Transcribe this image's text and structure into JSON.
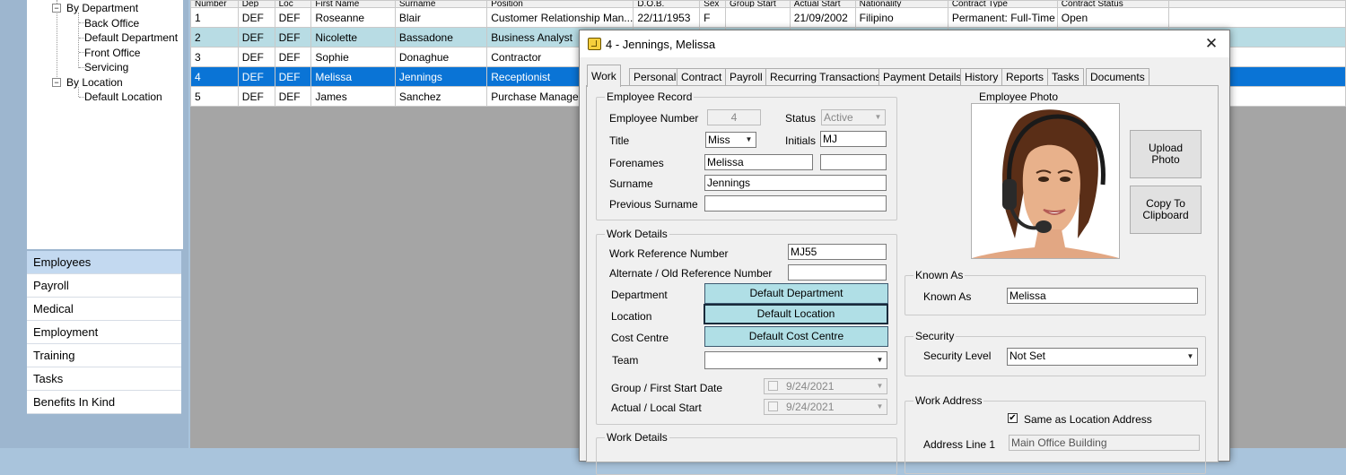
{
  "tree": {
    "by_department_label": "By Department",
    "departments": [
      "Back Office",
      "Default Department",
      "Front Office",
      "Servicing"
    ],
    "by_location_label": "By Location",
    "locations": [
      "Default Location"
    ],
    "expander": "−"
  },
  "modules": [
    "Employees",
    "Payroll",
    "Medical",
    "Employment",
    "Training",
    "Tasks",
    "Benefits In Kind"
  ],
  "grid": {
    "columns": [
      "Number",
      "Dep",
      "Loc",
      "First Name",
      "Surname",
      "Position",
      "D.O.B.",
      "Sex",
      "Group Start",
      "Actual Start",
      "Nationality",
      "Contract Type",
      "Contract Status"
    ],
    "rows": [
      [
        "1",
        "DEF",
        "DEF",
        "Roseanne",
        "Blair",
        "Customer Relationship Man...",
        "22/11/1953",
        "F",
        "",
        "21/09/2002",
        "Filipino",
        "Permanent: Full-Time",
        "Open"
      ],
      [
        "2",
        "DEF",
        "DEF",
        "Nicolette",
        "Bassadone",
        "Business Analyst",
        "",
        "",
        "",
        "",
        "",
        "",
        ""
      ],
      [
        "3",
        "DEF",
        "DEF",
        "Sophie",
        "Donaghue",
        "Contractor",
        "",
        "",
        "",
        "",
        "",
        "",
        ""
      ],
      [
        "4",
        "DEF",
        "DEF",
        "Melissa",
        "Jennings",
        "Receptionist",
        "",
        "",
        "",
        "",
        "",
        "",
        ""
      ],
      [
        "5",
        "DEF",
        "DEF",
        "James",
        "Sanchez",
        "Purchase Manager",
        "",
        "",
        "",
        "",
        "",
        "",
        ""
      ]
    ],
    "selected_row": 3
  },
  "dialog": {
    "title": "4 - Jennings, Melissa",
    "close_glyph": "✕",
    "tabs": [
      "Work",
      "Personal",
      "Contract",
      "Payroll",
      "Recurring Transactions",
      "Payment Details",
      "History",
      "Reports",
      "Tasks",
      "Documents"
    ],
    "active_tab": "Work",
    "employee_record": {
      "legend": "Employee Record",
      "employee_number_label": "Employee Number",
      "employee_number": "4",
      "status_label": "Status",
      "status": "Active",
      "title_label": "Title",
      "title": "Miss",
      "initials_label": "Initials",
      "initials": "MJ",
      "forenames_label": "Forenames",
      "forenames": "Melissa",
      "forenames_extra": "",
      "surname_label": "Surname",
      "surname": "Jennings",
      "previous_surname_label": "Previous Surname",
      "previous_surname": ""
    },
    "work_details": {
      "legend": "Work Details",
      "work_ref_label": "Work Reference Number",
      "work_ref": "MJ55",
      "alt_ref_label": "Alternate / Old Reference Number",
      "alt_ref": "",
      "department_label": "Department",
      "department": "Default Department",
      "location_label": "Location",
      "location": "Default Location",
      "cost_centre_label": "Cost Centre",
      "cost_centre": "Default Cost Centre",
      "team_label": "Team",
      "team": "",
      "group_start_label": "Group / First Start Date",
      "group_start": "9/24/2021",
      "actual_start_label": "Actual / Local Start",
      "actual_start": "9/24/2021"
    },
    "work_details_2": {
      "legend": "Work Details"
    },
    "photo": {
      "legend": "Employee Photo",
      "upload_label": "Upload Photo",
      "copy_label": "Copy To Clipboard"
    },
    "known_as": {
      "legend": "Known As",
      "label": "Known As",
      "value": "Melissa"
    },
    "security": {
      "legend": "Security",
      "label": "Security Level",
      "value": "Not Set"
    },
    "work_address": {
      "legend": "Work Address",
      "same_as_location_label": "Same as Location Address",
      "same_as_location": true,
      "address_line_1_label": "Address Line 1",
      "address_line_1": "Main Office Building"
    }
  },
  "colors": {
    "selected_row": "#0a74d6",
    "alt_row": "#b8dce4",
    "dept_button": "#b0dfe6"
  },
  "icons": {
    "dropdown": "▼",
    "check": "✔"
  }
}
